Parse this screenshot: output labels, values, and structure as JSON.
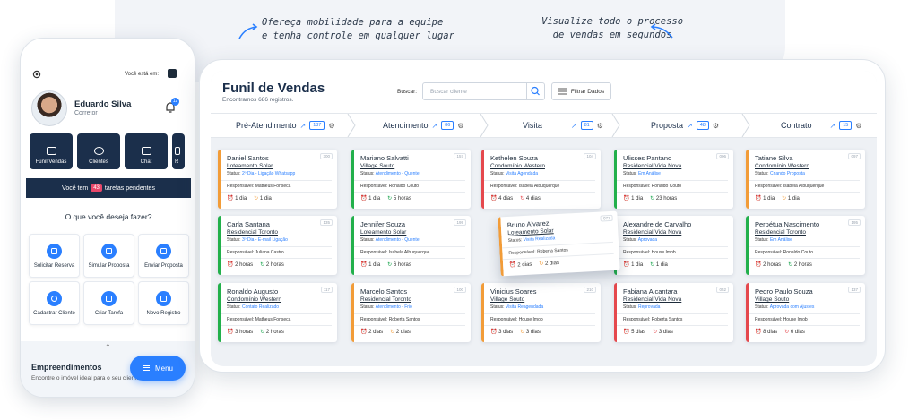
{
  "taglines": {
    "left": "Ofereça mobilidade para a equipe\ne tenha controle em qualquer lugar",
    "right": "Visualize todo o processo\nde vendas em segundos"
  },
  "phone": {
    "where_label": "Você está em:",
    "user_name": "Eduardo Silva",
    "user_role": "Corretor",
    "notif_count": "12",
    "tiles": [
      "Funil Vendas",
      "Clientes",
      "Chat",
      "R"
    ],
    "pending_prefix": "Você tem",
    "pending_count": "43",
    "pending_suffix": "tarefas pendentes",
    "question": "O que você deseja fazer?",
    "actions": [
      "Solicitar Reserva",
      "Simular Proposta",
      "Enviar Proposta",
      "Cadastrar Cliente",
      "Criar Tarefa",
      "Novo Registro"
    ],
    "section_title": "Empreendimentos",
    "section_sub": "Encontre o imóvel ideal para o seu cliente",
    "menu_label": "Menu"
  },
  "desktop": {
    "title": "Funil de Vendas",
    "subtitle": "Encontramos 686 registros.",
    "search_label": "Buscar:",
    "search_placeholder": "Buscar cliente",
    "filter_label": "Filtrar Dados",
    "stages": [
      {
        "name": "Pré-Atendimento",
        "count": "137"
      },
      {
        "name": "Atendimento",
        "count": "86"
      },
      {
        "name": "Visita",
        "count": "81"
      },
      {
        "name": "Proposta",
        "count": "48"
      },
      {
        "name": "Contrato",
        "count": "15"
      }
    ],
    "status_label": "Status:",
    "resp_label": "Responsável:",
    "cards": [
      {
        "name": "Daniel Santos",
        "project": "Loteamento Solar",
        "status": "2º Dia - Ligação Whatsapp",
        "resp": "Matheus Fonseca",
        "t1": "1 dia",
        "t2": "1 dia",
        "id": "300",
        "color": "orange"
      },
      {
        "name": "Carla Santana",
        "project": "Residencial Toronto",
        "status": "3º Dia - E-mail Ligação",
        "resp": "Juliana Castro",
        "t1": "2 horas",
        "t2": "2 horas",
        "id": "135",
        "color": "green"
      },
      {
        "name": "Ronaldo Augusto",
        "project": "Condomínio Western",
        "status": "Contato Realizado",
        "resp": "Matheus Fonseca",
        "t1": "3 horas",
        "t2": "2 horas",
        "id": "117",
        "color": "green"
      },
      {
        "name": "Mariano Salvatti",
        "project": "Village Souto",
        "status": "Atendimento - Quente",
        "resp": "Ronaldo Couto",
        "t1": "1 dia",
        "t2": "5 horas",
        "id": "157",
        "color": "green"
      },
      {
        "name": "Jennifer Souza",
        "project": "Loteamento Solar",
        "status": "Atendimento - Quente",
        "resp": "Isabela Albuquerque",
        "t1": "1 dia",
        "t2": "6 horas",
        "id": "199",
        "color": "green"
      },
      {
        "name": "Marcelo Santos",
        "project": "Residencial Toronto",
        "status": "Atendimento - Frio",
        "resp": "Roberta Santos",
        "t1": "2 dias",
        "t2": "2 dias",
        "id": "100",
        "color": "orange"
      },
      {
        "name": "Kethelen Souza",
        "project": "Condomínio Western",
        "status": "Visita Agendada",
        "resp": "Isabela Albuquerque",
        "t1": "4 dias",
        "t2": "4 dias",
        "id": "104",
        "color": "red"
      },
      {
        "name": "Bruno Alvarez",
        "project": "Loteamento Solar",
        "status": "Visita Realizada",
        "resp": "Roberta Santos",
        "t1": "2 dias",
        "t2": "2 dias",
        "id": "071",
        "color": "orange"
      },
      {
        "name": "Vinicius Soares",
        "project": "Village Souto",
        "status": "Visita Reagendada",
        "resp": "House Imob",
        "t1": "3 dias",
        "t2": "3 dias",
        "id": "210",
        "color": "orange"
      },
      {
        "name": "Ulisses Pantano",
        "project": "Residencial Vida Nova",
        "status": "Em Análise",
        "resp": "Ronaldo Couto",
        "t1": "1 dia",
        "t2": "23 horas",
        "id": "006",
        "color": "green"
      },
      {
        "name": "Alexandre de Carvalho",
        "project": "Residencial Vida Nova",
        "status": "Aprovada",
        "resp": "House Imob",
        "t1": "1 dia",
        "t2": "1 dia",
        "id": "",
        "color": "green"
      },
      {
        "name": "Fabiana Alcantara",
        "project": "Residencial Vida Nova",
        "status": "Reprovada",
        "resp": "Roberta Santos",
        "t1": "5 dias",
        "t2": "3 dias",
        "id": "052",
        "color": "red"
      },
      {
        "name": "Tatiane Silva",
        "project": "Condomínio Western",
        "status": "Criando Proposta",
        "resp": "Isabela Albuquerque",
        "t1": "1 dia",
        "t2": "1 dia",
        "id": "097",
        "color": "orange"
      },
      {
        "name": "Perpétua Nascimento",
        "project": "Residencial Toronto",
        "status": "Em Análise",
        "resp": "Ronaldo Couto",
        "t1": "2 horas",
        "t2": "2 horas",
        "id": "195",
        "color": "green"
      },
      {
        "name": "Pedro Paulo Souza",
        "project": "Village Souto",
        "status": "Aprovada com Ajustes",
        "resp": "House Imob",
        "t1": "8 dias",
        "t2": "6 dias",
        "id": "137",
        "color": "red"
      }
    ]
  },
  "colors": {
    "navy": "#1b2f4b",
    "blue": "#2a7fff",
    "green": "#22b04b",
    "orange": "#f29c38",
    "red": "#e5484d"
  }
}
